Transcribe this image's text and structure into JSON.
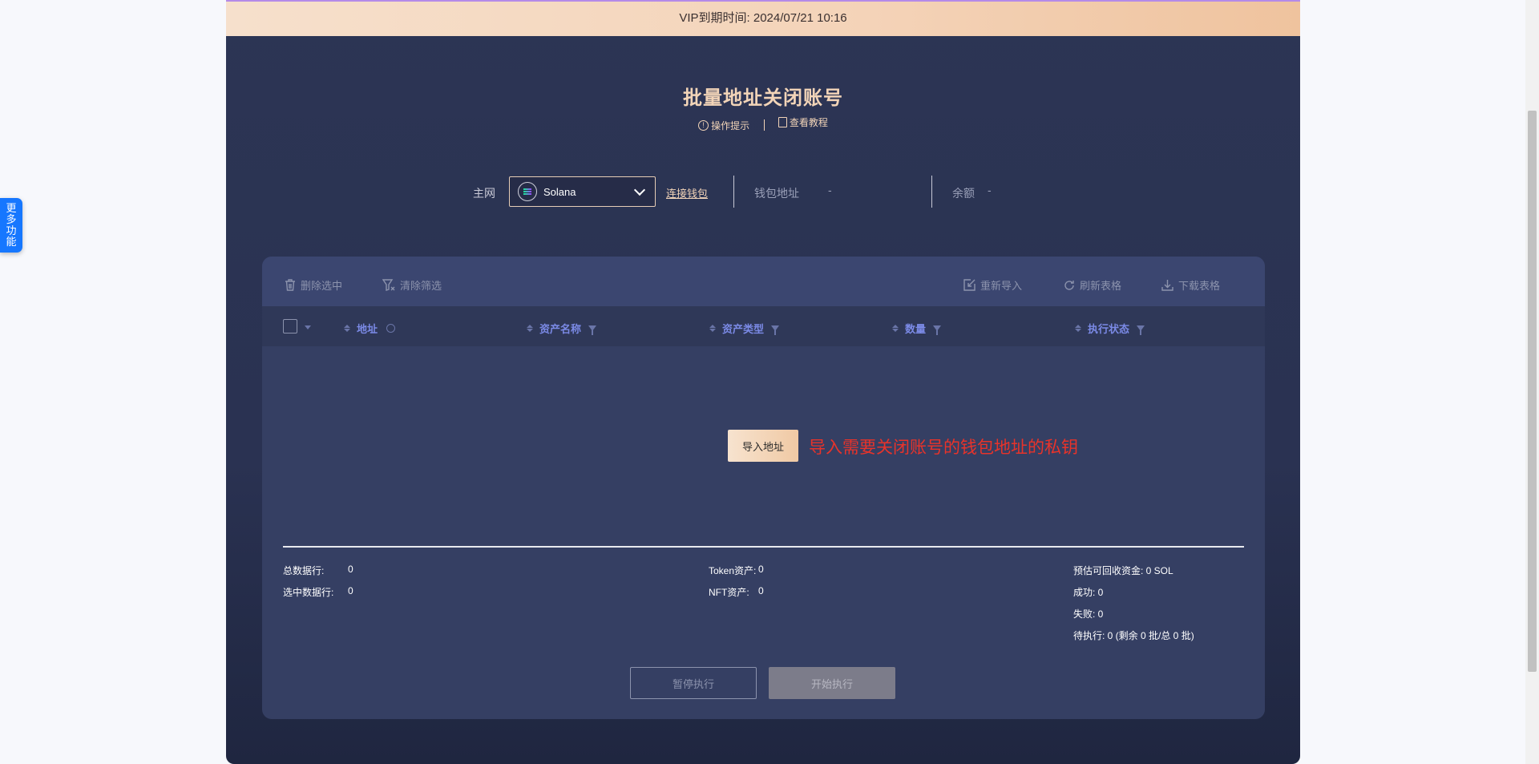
{
  "vip": {
    "text": "VIP到期时间: 2024/07/21 10:16"
  },
  "side_tab": {
    "label": "更多功能"
  },
  "header": {
    "title": "批量地址关闭账号",
    "tips_label": "操作提示",
    "tutorial_label": "查看教程"
  },
  "network": {
    "label": "主网",
    "selected": "Solana",
    "connect_label": "连接钱包",
    "wallet_address_label": "钱包地址",
    "wallet_address_value": "-",
    "balance_label": "余额",
    "balance_value": "-"
  },
  "toolbar": {
    "delete_selected": "删除选中",
    "clear_filter": "清除筛选",
    "reimport": "重新导入",
    "refresh": "刷新表格",
    "download": "下载表格"
  },
  "table": {
    "columns": [
      "地址",
      "资产名称",
      "资产类型",
      "数量",
      "执行状态"
    ]
  },
  "empty": {
    "import_button": "导入地址",
    "hint": "导入需要关闭账号的钱包地址的私钥"
  },
  "stats": {
    "total_rows_label": "总数据行:",
    "total_rows": "0",
    "selected_rows_label": "选中数据行:",
    "selected_rows": "0",
    "token_label": "Token资产:",
    "token_value": "0",
    "nft_label": "NFT资产:",
    "nft_value": "0",
    "recoverable": "预估可回收资金: 0 SOL",
    "success": "成功: 0",
    "failed": "失败: 0",
    "pending": "待执行: 0 (剩余 0 批/总 0 批)"
  },
  "actions": {
    "pause": "暂停执行",
    "start": "开始执行"
  }
}
